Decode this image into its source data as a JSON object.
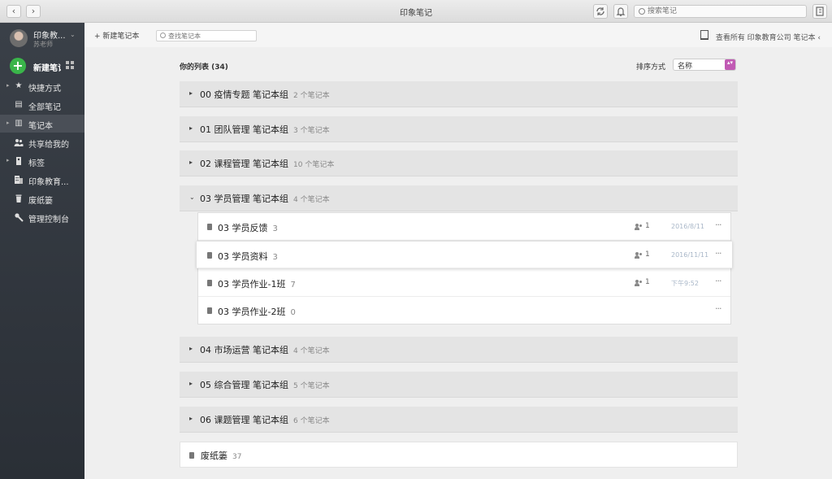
{
  "window": {
    "title": "印象笔记",
    "back": "‹",
    "forward": "›"
  },
  "search": {
    "placeholder": "搜索笔记"
  },
  "account": {
    "name": "印象教...",
    "subtitle": "苏老师",
    "chevron": "⌄"
  },
  "sidebar": {
    "new_note_label": "新建笔记",
    "items": [
      {
        "label": "快捷方式",
        "icon": "star-icon",
        "glyph": "★",
        "caret": "▸"
      },
      {
        "label": "全部笔记",
        "icon": "note-icon",
        "glyph": "▤",
        "caret": ""
      },
      {
        "label": "笔记本",
        "icon": "notebook-icon",
        "glyph": "▥",
        "caret": "▸"
      },
      {
        "label": "共享给我的",
        "icon": "people-icon",
        "glyph": "👥",
        "caret": ""
      },
      {
        "label": "标签",
        "icon": "tag-icon",
        "glyph": "◆",
        "caret": "▸"
      },
      {
        "label": "印象教育...",
        "icon": "building-icon",
        "glyph": "▦",
        "caret": ""
      },
      {
        "label": "废纸篓",
        "icon": "trash-icon",
        "glyph": "▮",
        "caret": ""
      },
      {
        "label": "管理控制台",
        "icon": "wrench-icon",
        "glyph": "✎",
        "caret": ""
      }
    ]
  },
  "toolbar": {
    "new_notebook": "+ 新建笔记本",
    "find_placeholder": "查找笔记本",
    "view_all": "查看所有 印象教育公司 笔记本 ‹"
  },
  "list": {
    "header": "你的列表 (34)",
    "sort_label": "排序方式",
    "sort_value": "名称",
    "sort_arrows": "▴▾",
    "groups": [
      {
        "caret": "▸",
        "name": "00 疫情专题 笔记本组",
        "count": "2 个笔记本"
      },
      {
        "caret": "▸",
        "name": "01 团队管理 笔记本组",
        "count": "3 个笔记本"
      },
      {
        "caret": "▸",
        "name": "02 课程管理 笔记本组",
        "count": "10 个笔记本"
      },
      {
        "caret": "⌄",
        "name": "03 学员管理 笔记本组",
        "count": "4 个笔记本"
      },
      {
        "caret": "▸",
        "name": "04 市场运营 笔记本组",
        "count": "4 个笔记本"
      },
      {
        "caret": "▸",
        "name": "05 综合管理 笔记本组",
        "count": "5 个笔记本"
      },
      {
        "caret": "▸",
        "name": "06 课题管理 笔记本组",
        "count": "6 个笔记本"
      }
    ],
    "notebooks": [
      {
        "name": "03 学员反馈",
        "count": "3",
        "shared": "1",
        "date": "2016/8/11",
        "more": "···"
      },
      {
        "name": "03 学员资料",
        "count": "3",
        "shared": "1",
        "date": "2016/11/11",
        "more": "···"
      },
      {
        "name": "03 学员作业-1班",
        "count": "7",
        "shared": "1",
        "date": "下午9:52",
        "more": "···"
      },
      {
        "name": "03 学员作业-2班",
        "count": "0",
        "shared": "",
        "date": "",
        "more": "···"
      }
    ],
    "trash": {
      "name": "废纸篓",
      "count": "37"
    }
  },
  "colors": {
    "accent_green": "#3ab54a",
    "sort_purple": "#c15ab4",
    "sidebar_bg": "#2f343b"
  }
}
